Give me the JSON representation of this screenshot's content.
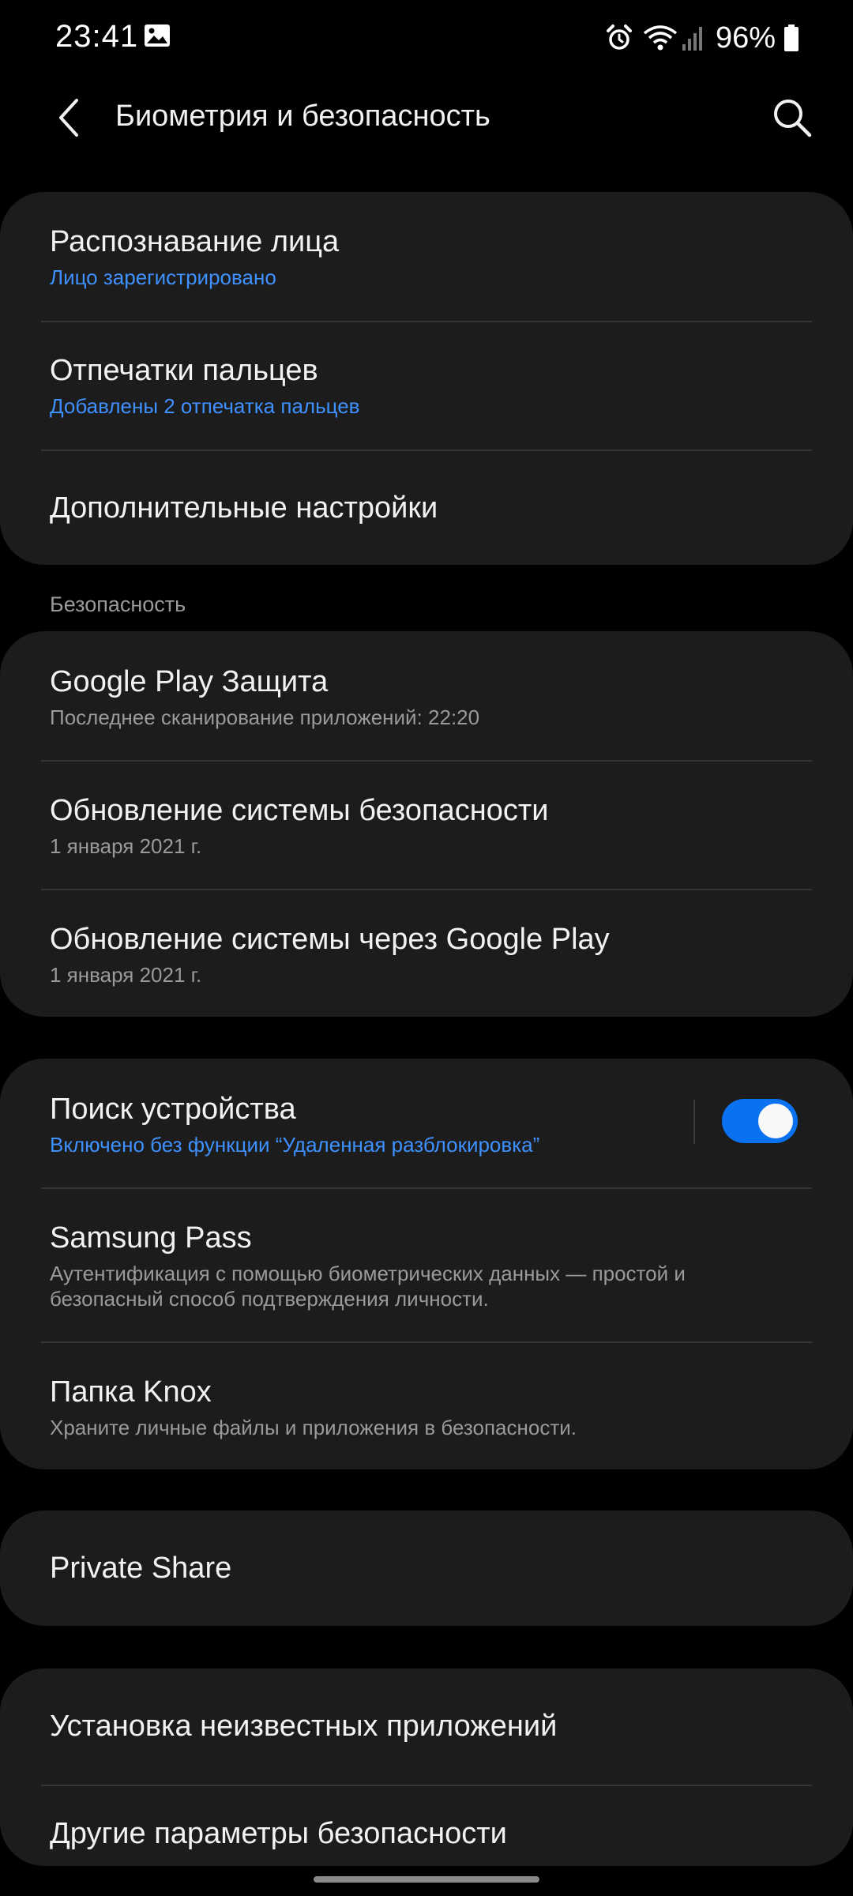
{
  "status_bar": {
    "time": "23:41",
    "battery_text": "96%",
    "icons": [
      "gallery-icon",
      "alarm-icon",
      "wifi-icon",
      "signal-icon",
      "battery-icon"
    ]
  },
  "app_bar": {
    "title": "Биометрия и безопасность",
    "back_icon": "chevron-left-icon",
    "search_icon": "search-icon"
  },
  "biometrics": {
    "items": [
      {
        "title": "Распознавание лица",
        "subtitle": "Лицо зарегистрировано"
      },
      {
        "title": "Отпечатки пальцев",
        "subtitle": "Добавлены 2 отпечатка пальцев"
      },
      {
        "title": "Дополнительные настройки"
      }
    ]
  },
  "security": {
    "header": "Безопасность",
    "items": [
      {
        "title": "Google Play Защита",
        "subtitle": "Последнее сканирование приложений: 22:20"
      },
      {
        "title": "Обновление системы безопасности",
        "subtitle": "1 января 2021 г."
      },
      {
        "title": "Обновление системы через Google Play",
        "subtitle": "1 января 2021 г."
      }
    ]
  },
  "device": {
    "items": [
      {
        "title": "Поиск устройства",
        "subtitle": "Включено без функции “Удаленная разблокировка”",
        "toggle_on": true
      },
      {
        "title": "Samsung Pass",
        "subtitle": "Аутентификация с помощью биометрических данных — простой и безопасный способ подтверждения личности."
      },
      {
        "title": "Папка Knox",
        "subtitle": "Храните личные файлы и приложения в безопасности."
      }
    ]
  },
  "share": {
    "items": [
      {
        "title": "Private Share"
      }
    ]
  },
  "other": {
    "items": [
      {
        "title": "Установка неизвестных приложений"
      },
      {
        "title": "Другие параметры безопасности"
      }
    ]
  },
  "colors": {
    "background": "#000000",
    "card": "#1c1c1c",
    "accent": "#3e91ff",
    "toggle": "#0a72f0"
  }
}
